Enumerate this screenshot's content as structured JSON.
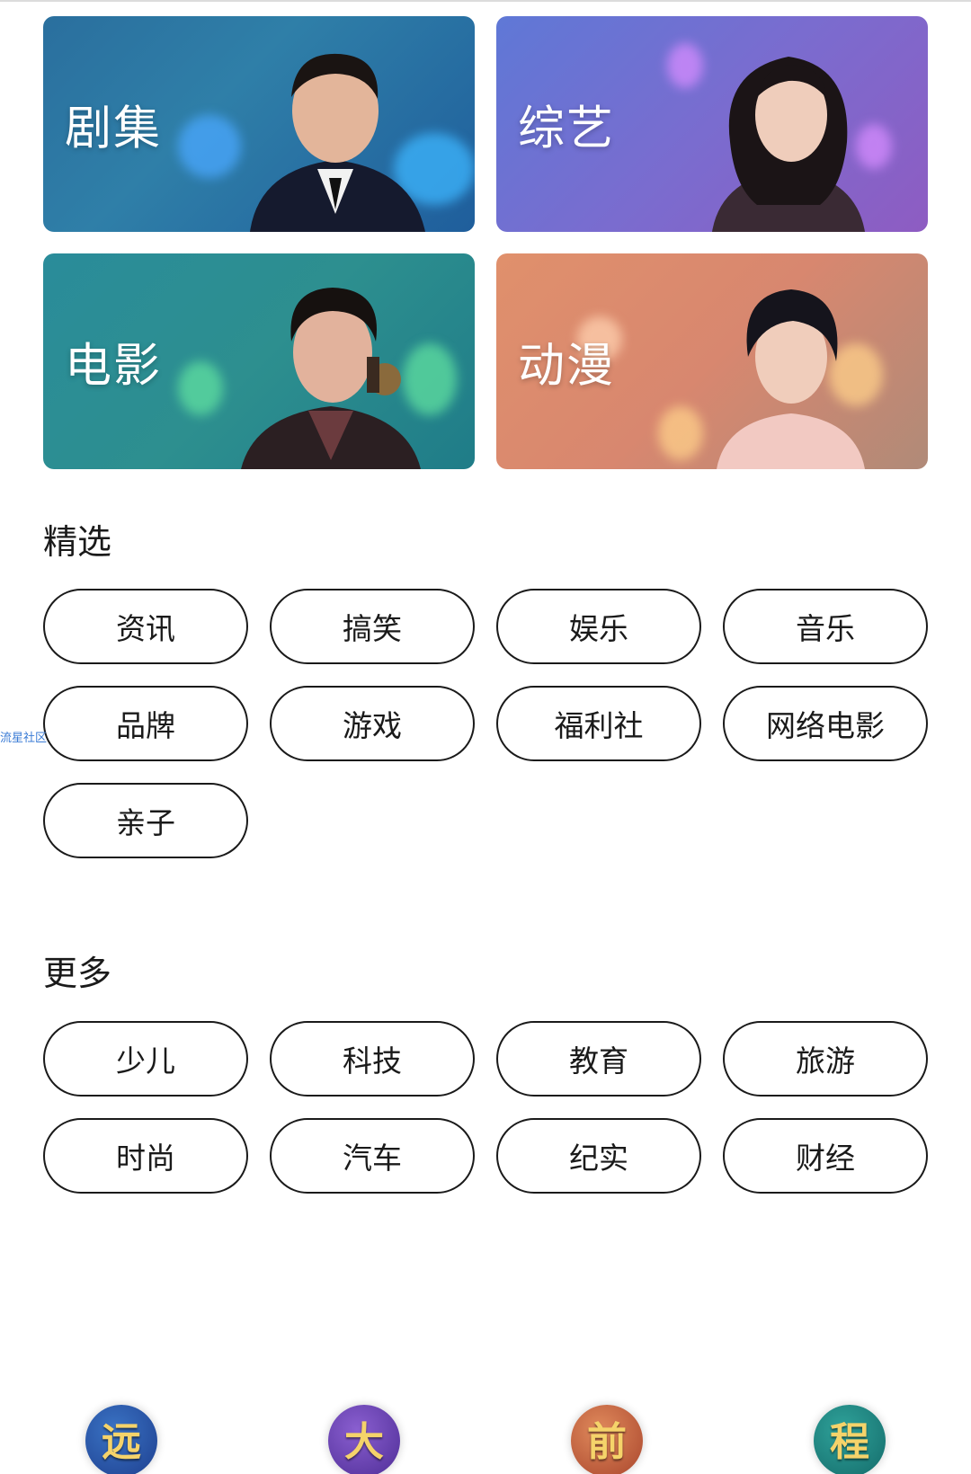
{
  "categories": [
    {
      "title": "剧集",
      "accent": "#2a6f9e"
    },
    {
      "title": "综艺",
      "accent": "#7a6ccf"
    },
    {
      "title": "电影",
      "accent": "#2a8c9a"
    },
    {
      "title": "动漫",
      "accent": "#e0906c"
    }
  ],
  "featured": {
    "title": "精选",
    "items": [
      "资讯",
      "搞笑",
      "娱乐",
      "音乐",
      "品牌",
      "游戏",
      "福利社",
      "网络电影",
      "亲子"
    ]
  },
  "more": {
    "title": "更多",
    "items": [
      "少儿",
      "科技",
      "教育",
      "旅游",
      "时尚",
      "汽车",
      "纪实",
      "财经"
    ]
  },
  "watermark": "流星社区",
  "bottom_tabs": [
    {
      "label": "远",
      "color": "#1e3f8f"
    },
    {
      "label": "大",
      "color": "#4e2d96"
    },
    {
      "label": "前",
      "color": "#a9452c"
    },
    {
      "label": "程",
      "color": "#146b6a"
    }
  ]
}
